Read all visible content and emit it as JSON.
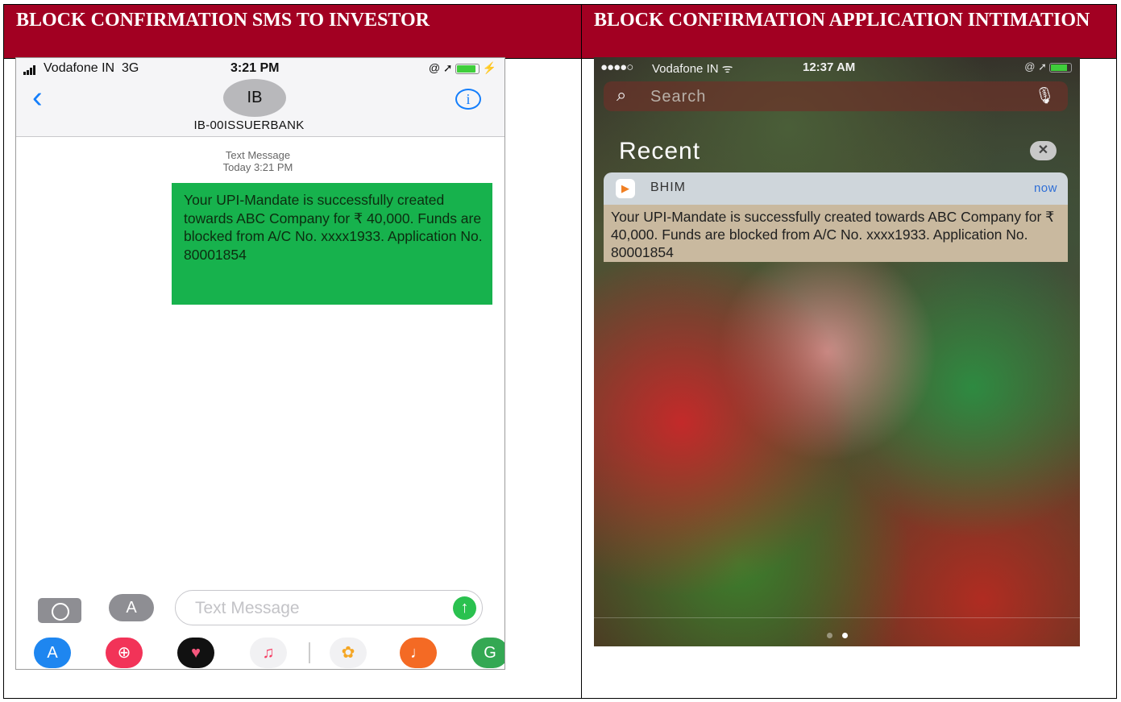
{
  "headers": {
    "left": "BLOCK CONFIRMATION SMS TO INVESTOR",
    "right": "BLOCK CONFIRMATION APPLICATION INTIMATION"
  },
  "colors": {
    "header_bg": "#a20022",
    "sms_bubble": "#17b24d",
    "ios_blue": "#147efb"
  },
  "sms_phone": {
    "status": {
      "carrier": "Vodafone IN",
      "network": "3G",
      "time": "3:21 PM",
      "icons": "@ ➚"
    },
    "back_icon": "chevron-left-icon",
    "avatar_initials": "IB",
    "sender": "IB-00ISSUERBANK",
    "info_icon": "info-icon",
    "meta": {
      "type": "Text Message",
      "when": "Today 3:21 PM"
    },
    "message": "Your UPI-Mandate is successfully created towards ABC Company for ₹ 40,000. Funds are blocked from A/C No. xxxx1933. Application No. 80001854",
    "compose_placeholder": "Text Message",
    "tray_icons": [
      "app-store-icon",
      "web-search-icon",
      "heart-icon",
      "music-icon",
      "photos-icon",
      "garageband-icon",
      "maps-icon"
    ]
  },
  "notif_phone": {
    "status": {
      "dots": "●●●●○",
      "carrier": "Vodafone IN",
      "wifi": "ᯤ",
      "time": "12:37 AM",
      "icons": "@ ➚"
    },
    "search_placeholder": "Search",
    "recent_label": "Recent",
    "clear_label": "✕",
    "notification": {
      "app": "BHIM",
      "time": "now",
      "body": "Your UPI-Mandate is successfully created towards ABC Company for ₹ 40,000. Funds are blocked from A/C No. xxxx1933. Application No. 80001854"
    }
  }
}
